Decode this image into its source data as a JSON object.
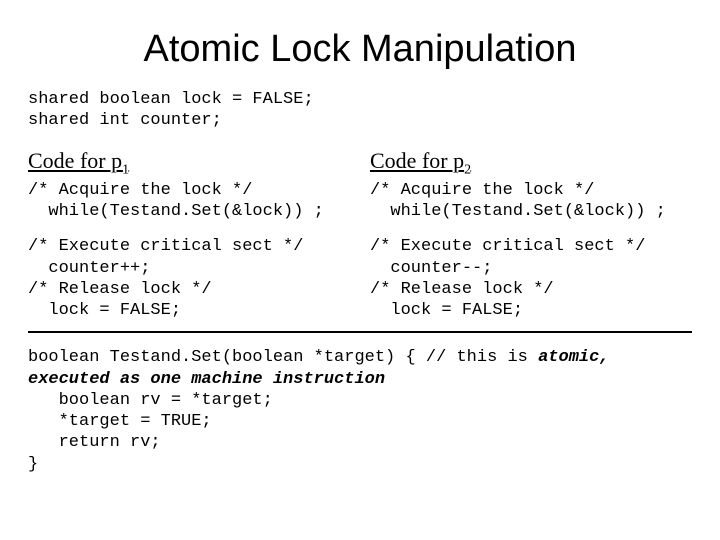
{
  "title": "Atomic Lock Manipulation",
  "decl": "shared boolean lock = FALSE;\nshared int counter;",
  "p1": {
    "heading": "Code for p",
    "sub": "1",
    "acquire": "/* Acquire the lock */\n  while(Testand.Set(&lock)) ;",
    "body": "/* Execute critical sect */\n  counter++;\n/* Release lock */\n  lock = FALSE;"
  },
  "p2": {
    "heading": "Code for p",
    "sub": "2",
    "acquire": "/* Acquire the lock */\n  while(Testand.Set(&lock)) ;",
    "body": "/* Execute critical sect */\n  counter--;\n/* Release lock */\n  lock = FALSE;"
  },
  "func": {
    "sig_pre": "boolean Testand.Set(boolean *target) {  // this is ",
    "sig_em1": "atomic,",
    "line2_em": "executed as one machine instruction",
    "rest": "   boolean rv = *target;\n   *target = TRUE;\n   return rv;\n}"
  }
}
